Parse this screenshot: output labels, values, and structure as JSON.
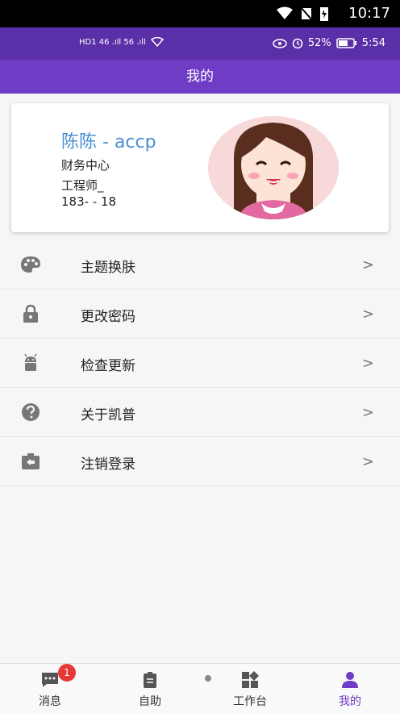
{
  "system_bar": {
    "time": "10:17"
  },
  "status_bar": {
    "left_network": "HD1 46 .ıll 56 .ıll",
    "battery": "52%",
    "time": "5:54"
  },
  "app_bar": {
    "title": "我的"
  },
  "profile": {
    "name": "陈陈 - accp",
    "department": "财务中心",
    "title": "工程师_",
    "phone": "183-  -  18"
  },
  "menu": {
    "items": [
      {
        "label": "主题换肤",
        "icon": "palette-icon"
      },
      {
        "label": "更改密码",
        "icon": "lock-icon"
      },
      {
        "label": "检查更新",
        "icon": "android-icon"
      },
      {
        "label": "关于凯普",
        "icon": "help-icon"
      },
      {
        "label": "注销登录",
        "icon": "logout-icon"
      }
    ],
    "chevron": ">"
  },
  "tabbar": {
    "tabs": [
      {
        "label": "消息",
        "badge": "1",
        "icon": "message-icon"
      },
      {
        "label": "自助",
        "icon": "clipboard-icon"
      },
      {
        "label": "工作台",
        "icon": "dashboard-icon"
      },
      {
        "label": "我的",
        "icon": "person-icon",
        "active": true
      }
    ]
  },
  "colors": {
    "primary": "#6f3cc6",
    "status": "#5b2fa7",
    "name": "#4b8fd3",
    "badge": "#e53935"
  }
}
